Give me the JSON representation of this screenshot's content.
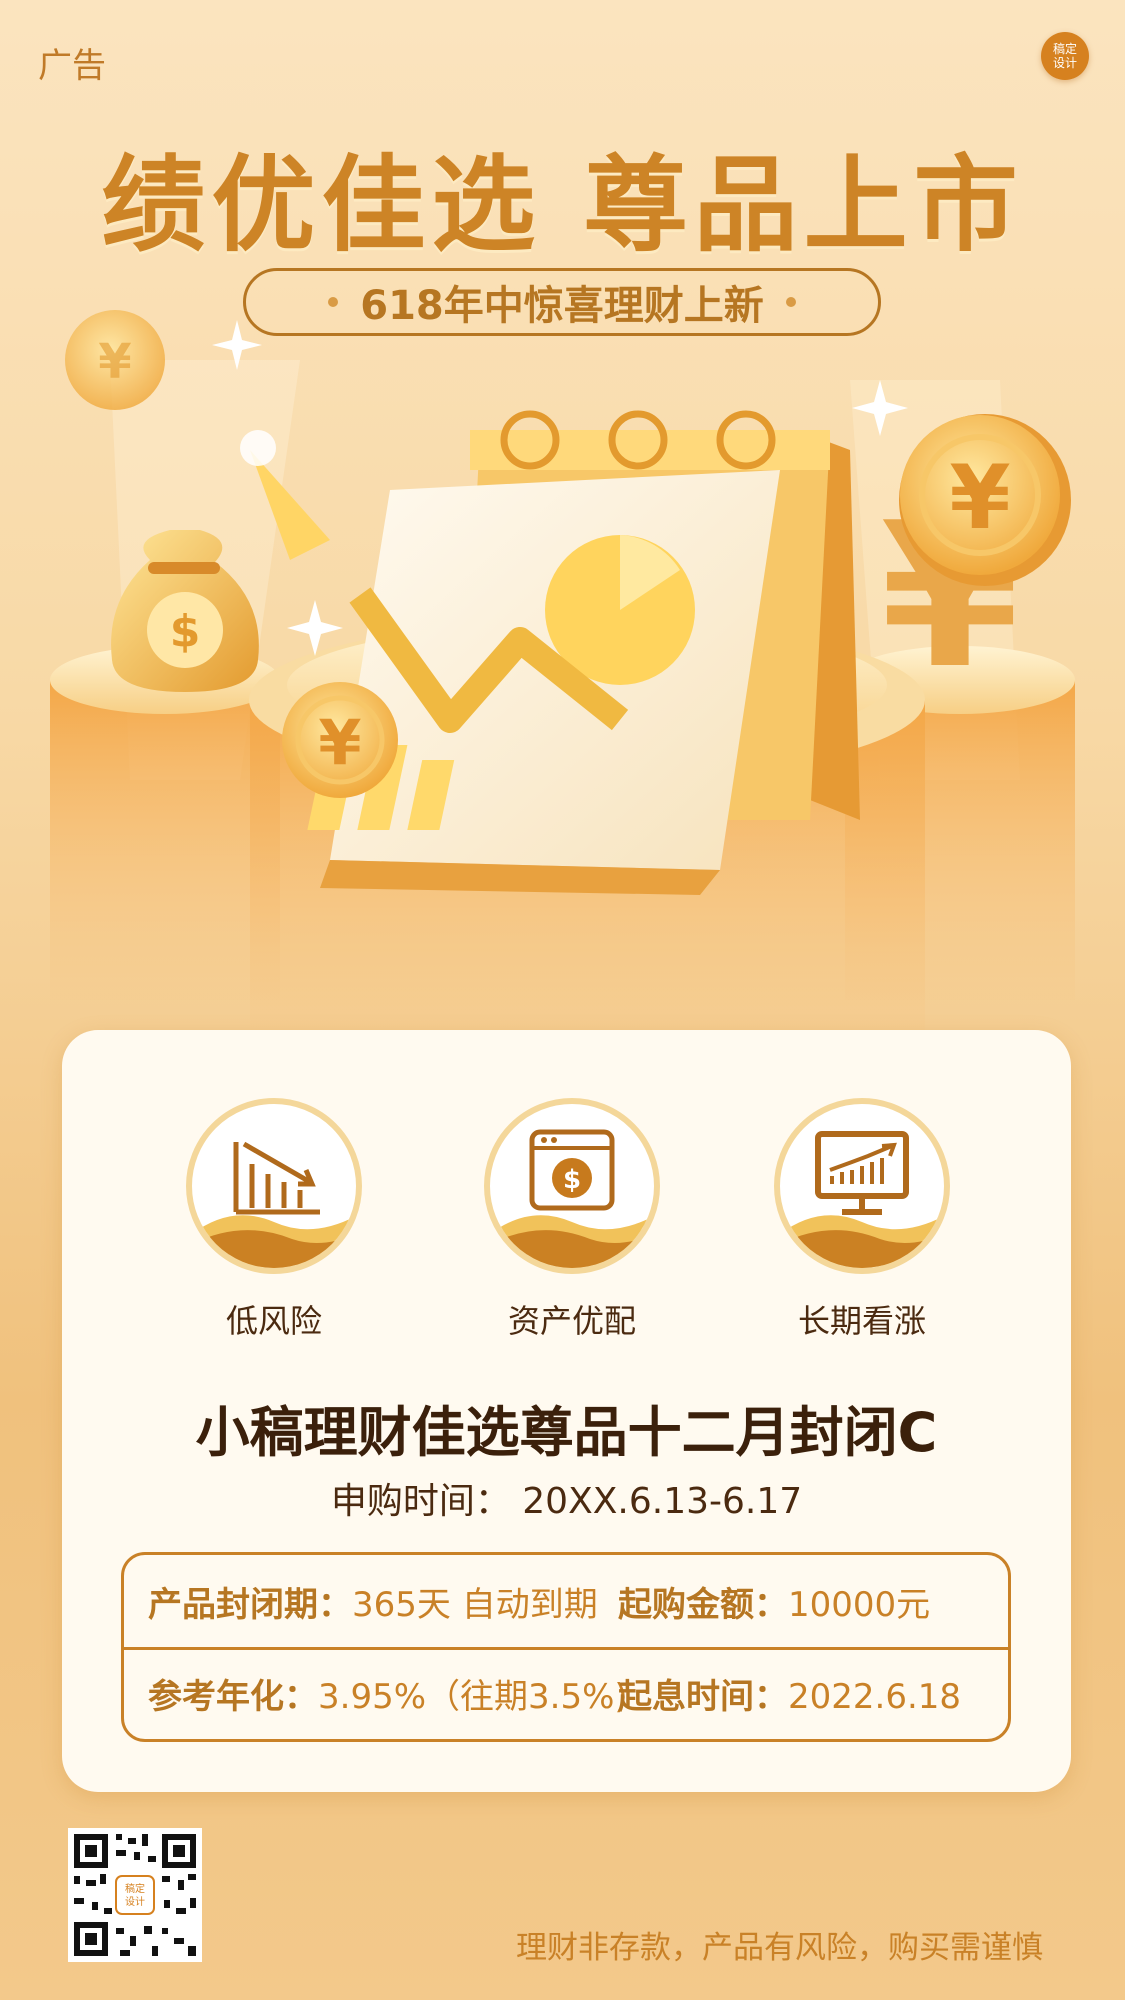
{
  "header": {
    "ad_label": "广告",
    "brand_badge_line1": "稿定",
    "brand_badge_line2": "设计",
    "headline": "绩优佳选 尊品上市",
    "pill_text": "618年中惊喜理财上新"
  },
  "hero": {
    "yen_symbol": "¥",
    "dollar_symbol": "$"
  },
  "card": {
    "features": [
      {
        "label": "低风险",
        "icon": "bar-chart-down-icon"
      },
      {
        "label": "资产优配",
        "icon": "dollar-window-icon"
      },
      {
        "label": "长期看涨",
        "icon": "monitor-trend-up-icon"
      }
    ],
    "product_title": "小稿理财佳选尊品十二月封闭C",
    "subscribe_label": "申购时间：",
    "subscribe_value": "20XX.6.13-6.17",
    "info": {
      "closed_period_label": "产品封闭期：",
      "closed_period_value": "365天 自动到期",
      "min_amount_label": "起购金额：",
      "min_amount_value": "10000元",
      "annualized_label": "参考年化：",
      "annualized_value": "3.95%（往期3.5%)",
      "interest_start_label": "起息时间：",
      "interest_start_value": "2022.6.18"
    }
  },
  "footer": {
    "disclaimer": "理财非存款，产品有风险，购买需谨慎",
    "qr_badge_line1": "稿定",
    "qr_badge_line2": "设计"
  },
  "colors": {
    "accent": "#cd8426",
    "dark_text": "#3b200b",
    "card_bg": "#fffaf0"
  }
}
